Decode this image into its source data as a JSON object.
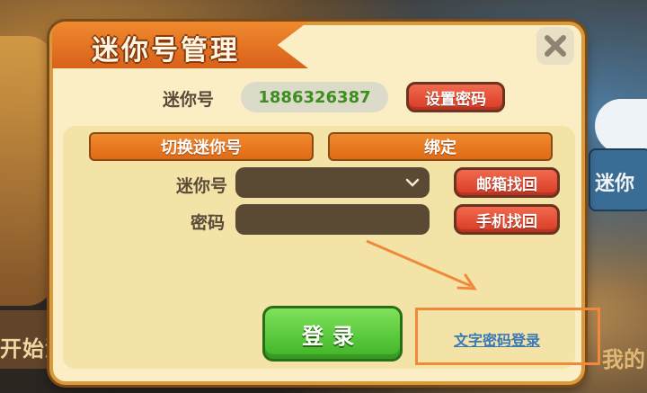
{
  "dialog": {
    "title": "迷你号管理",
    "close_icon": "close-icon"
  },
  "account": {
    "label": "迷你号",
    "value": "1886326387",
    "set_password_label": "设置密码"
  },
  "tabs": [
    {
      "label": "切换迷你号"
    },
    {
      "label": "绑定"
    }
  ],
  "form": {
    "id_label": "迷你号",
    "id_value": "",
    "password_label": "密码",
    "password_value": "",
    "recover_email_label": "邮箱找回",
    "recover_phone_label": "手机找回"
  },
  "actions": {
    "login_label": "登录",
    "text_password_login_label": "文字密码登录"
  },
  "background": {
    "left_text": "开始游",
    "right_tile_text": "迷你",
    "bottom_right_text": "我的"
  },
  "colors": {
    "panel_bg": "#fbeec4",
    "accent_orange": "#e16a16",
    "accent_red": "#d83a25",
    "login_green": "#3fb326",
    "link_blue": "#3a78b8",
    "highlight_orange": "#f08a3a",
    "id_green": "#3c8f1e"
  }
}
